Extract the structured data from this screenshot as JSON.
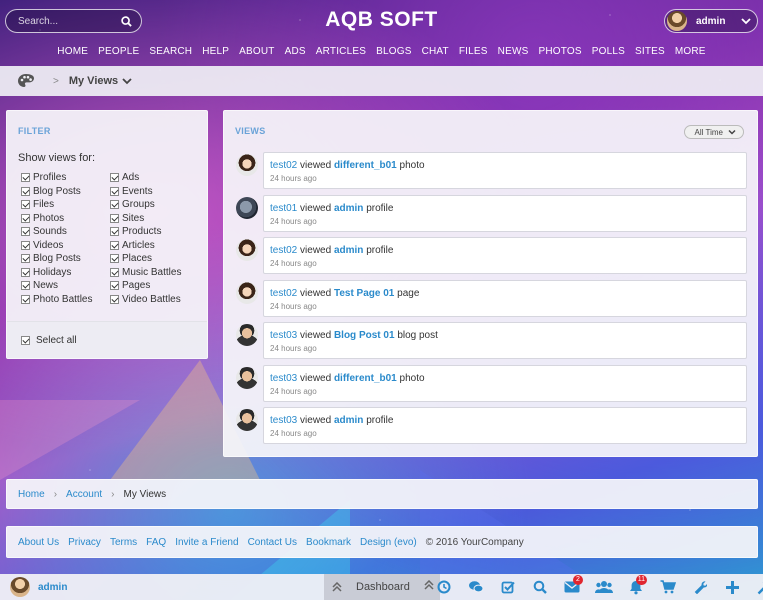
{
  "header": {
    "search_placeholder": "Search...",
    "site_title": "AQB SOFT",
    "user_name": "admin",
    "nav": [
      "HOME",
      "PEOPLE",
      "SEARCH",
      "HELP",
      "ABOUT",
      "ADS",
      "ARTICLES",
      "BLOGS",
      "CHAT",
      "FILES",
      "NEWS",
      "PHOTOS",
      "POLLS",
      "SITES",
      "MORE"
    ]
  },
  "crumbbar": {
    "sep": ">",
    "current": "My Views"
  },
  "filter": {
    "title": "FILTER",
    "show_label": "Show views for:",
    "col1": [
      "Profiles",
      "Blog Posts",
      "Files",
      "Photos",
      "Sounds",
      "Videos",
      "Blog Posts",
      "Holidays",
      "News",
      "Photo Battles"
    ],
    "col2": [
      "Ads",
      "Events",
      "Groups",
      "Sites",
      "Products",
      "Articles",
      "Places",
      "Music Battles",
      "Pages",
      "Video Battles"
    ],
    "select_all": "Select all"
  },
  "views": {
    "title": "VIEWS",
    "range": "All Time",
    "items": [
      {
        "user": "test02",
        "verb": "viewed",
        "object": "different_b01",
        "type": "photo",
        "time": "24 hours ago",
        "avatar": "female"
      },
      {
        "user": "test01",
        "verb": "viewed",
        "object": "admin",
        "type": "profile",
        "time": "24 hours ago",
        "avatar": "admin"
      },
      {
        "user": "test02",
        "verb": "viewed",
        "object": "admin",
        "type": "profile",
        "time": "24 hours ago",
        "avatar": "female"
      },
      {
        "user": "test02",
        "verb": "viewed",
        "object": "Test Page 01",
        "type": "page",
        "time": "24 hours ago",
        "avatar": "female"
      },
      {
        "user": "test03",
        "verb": "viewed",
        "object": "Blog Post 01",
        "type": "blog post",
        "time": "24 hours ago",
        "avatar": "male"
      },
      {
        "user": "test03",
        "verb": "viewed",
        "object": "different_b01",
        "type": "photo",
        "time": "24 hours ago",
        "avatar": "male"
      },
      {
        "user": "test03",
        "verb": "viewed",
        "object": "admin",
        "type": "profile",
        "time": "24 hours ago",
        "avatar": "male"
      }
    ]
  },
  "breadcrumb": {
    "home": "Home",
    "account": "Account",
    "current": "My Views",
    "sep": "›"
  },
  "footer": {
    "links": [
      "About Us",
      "Privacy",
      "Terms",
      "FAQ",
      "Invite a Friend",
      "Contact Us",
      "Bookmark",
      "Design (evo)"
    ],
    "copyright": "© 2016 YourCompany"
  },
  "toolbar": {
    "user_name": "admin",
    "dashboard_label": "Dashboard",
    "icons": [
      {
        "name": "notifications-history-icon",
        "badge": ""
      },
      {
        "name": "chat-icon",
        "badge": ""
      },
      {
        "name": "tasks-check-icon",
        "badge": ""
      },
      {
        "name": "search-icon",
        "badge": ""
      },
      {
        "name": "mail-icon",
        "badge": "2"
      },
      {
        "name": "friends-icon",
        "badge": ""
      },
      {
        "name": "bell-icon",
        "badge": "11"
      },
      {
        "name": "cart-icon",
        "badge": ""
      },
      {
        "name": "wrench-icon",
        "badge": ""
      },
      {
        "name": "plus-icon",
        "badge": ""
      },
      {
        "name": "magic-wand-icon",
        "badge": ""
      }
    ]
  },
  "colors": {
    "link": "#2a8acb",
    "accent_title": "#6aa3d8",
    "badge": "#e0262f"
  }
}
